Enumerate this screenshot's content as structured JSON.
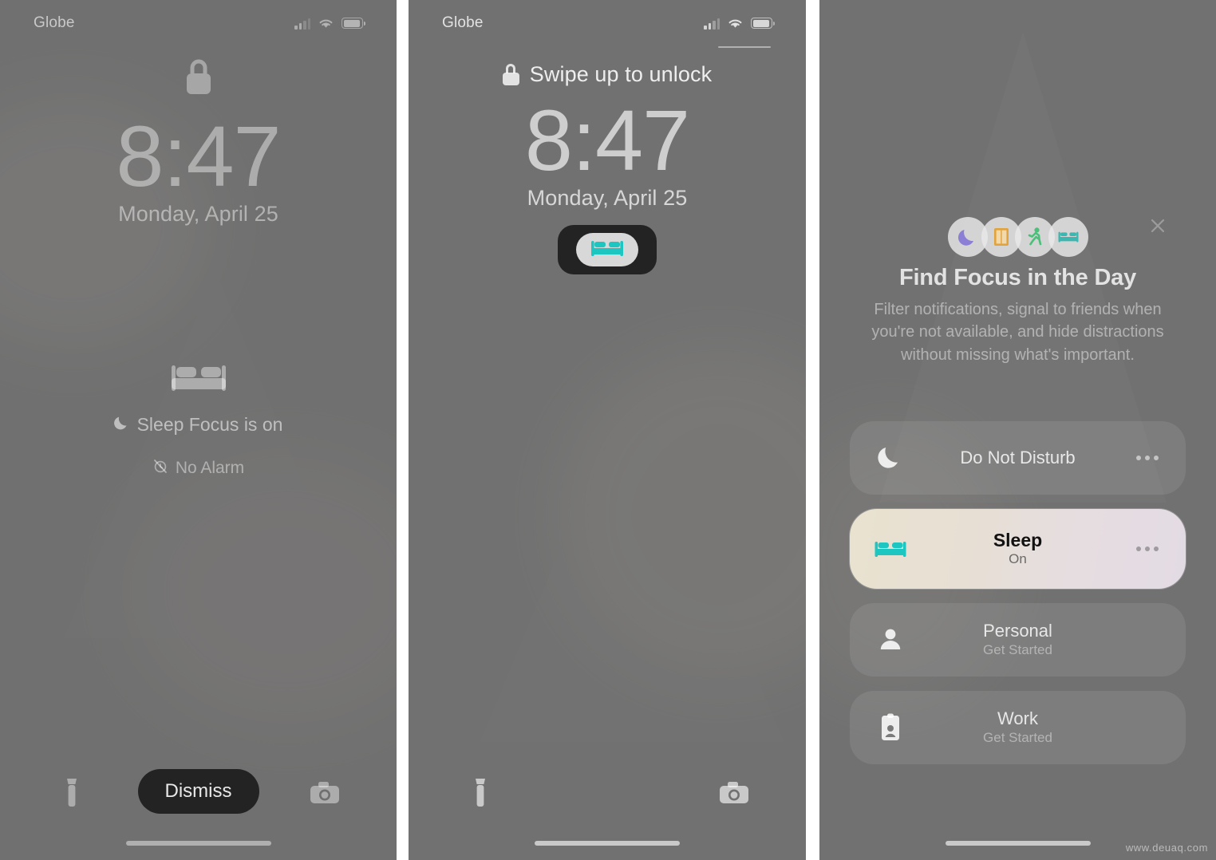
{
  "panels": [
    {
      "id": "lockscreen-dimmed",
      "status_bar": {
        "carrier": "Globe",
        "signal_icon": "cellular-signal-icon",
        "wifi_icon": "wifi-icon",
        "battery_icon": "battery-icon"
      },
      "lock_icon": "lock-icon",
      "time": "8:47",
      "date": "Monday, April 25",
      "sleep_focus": {
        "bed_icon": "bed-icon",
        "moon_icon": "moon-icon",
        "status_text": "Sleep Focus is on",
        "alarm_icon": "alarm-off-icon",
        "alarm_text": "No Alarm"
      },
      "bottom": {
        "flashlight_icon": "flashlight-icon",
        "camera_icon": "camera-icon",
        "dismiss_label": "Dismiss"
      }
    },
    {
      "id": "lockscreen-awake",
      "status_bar": {
        "carrier": "Globe",
        "signal_icon": "cellular-signal-icon",
        "wifi_icon": "wifi-icon",
        "battery_icon": "battery-icon"
      },
      "swipe": {
        "lock_icon": "lock-icon",
        "text": "Swipe up to unlock"
      },
      "time": "8:47",
      "date": "Monday, April 25",
      "focus_pill": {
        "bed_icon": "bed-icon",
        "accent": "#1dc6c0"
      },
      "bottom": {
        "flashlight_icon": "flashlight-icon",
        "camera_icon": "camera-icon"
      }
    },
    {
      "id": "focus-setup-sheet",
      "cluster": [
        {
          "icon": "moon-icon",
          "color": "#8a7fd4"
        },
        {
          "icon": "book-icon",
          "color": "#e0a33e"
        },
        {
          "icon": "runner-icon",
          "color": "#4cbf7a"
        },
        {
          "icon": "bed-icon",
          "color": "#3cb6b0"
        }
      ],
      "close_icon": "close-icon",
      "title": "Find Focus in the Day",
      "subtitle": "Filter notifications, signal to friends when you're not available, and hide distractions without missing what's important.",
      "rows": [
        {
          "icon": "moon-icon",
          "title": "Do Not Disturb",
          "subtitle": "",
          "state": "inactive",
          "more_icon": "more-ellipsis-icon"
        },
        {
          "icon": "bed-icon",
          "title": "Sleep",
          "subtitle": "On",
          "state": "active",
          "more_icon": "more-ellipsis-icon"
        },
        {
          "icon": "person-icon",
          "title": "Personal",
          "subtitle": "Get Started",
          "state": "inactive",
          "more_icon": ""
        },
        {
          "icon": "badge-icon",
          "title": "Work",
          "subtitle": "Get Started",
          "state": "inactive",
          "more_icon": ""
        }
      ]
    }
  ],
  "watermark": "www.deuaq.com"
}
